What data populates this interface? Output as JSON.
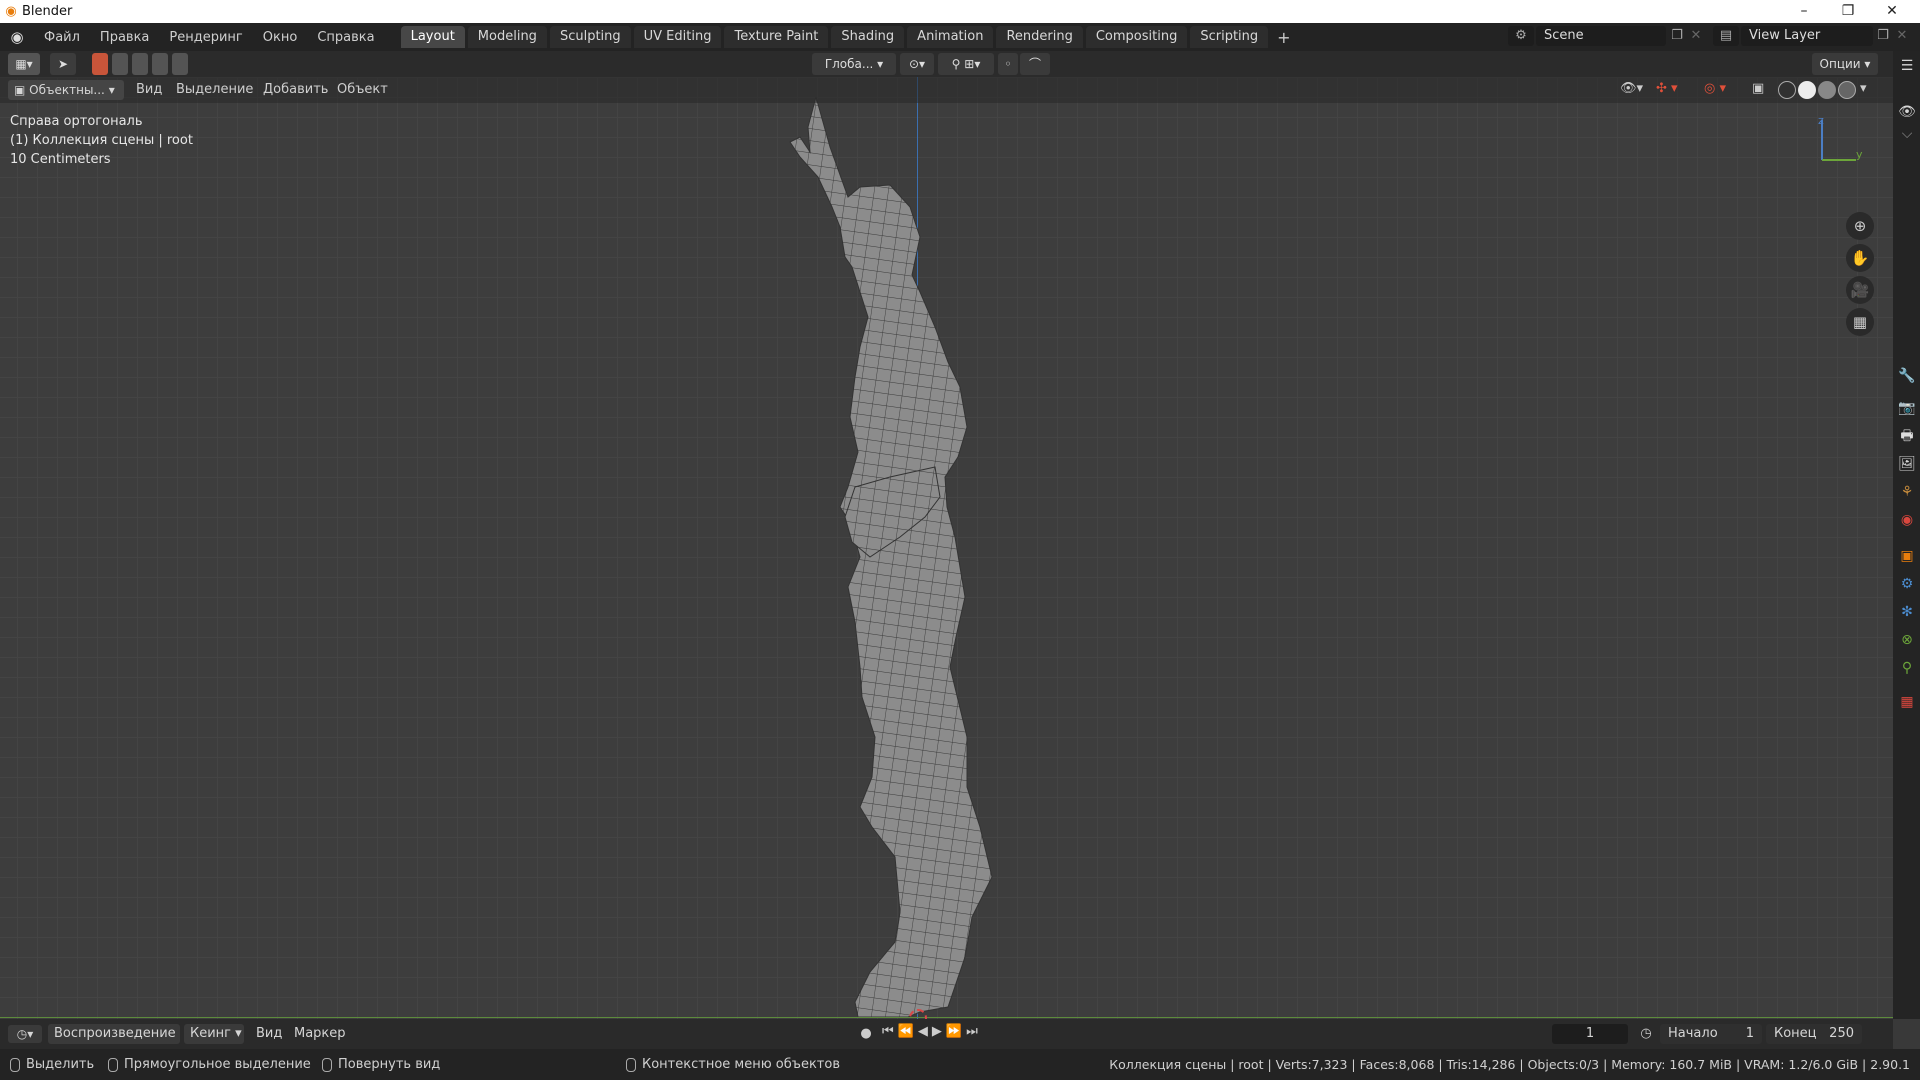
{
  "window": {
    "title": "Blender",
    "minimize": "–",
    "restore": "❐",
    "close": "✕"
  },
  "menu": [
    "Файл",
    "Правка",
    "Рендеринг",
    "Окно",
    "Справка"
  ],
  "workspaces": [
    "Layout",
    "Modeling",
    "Sculpting",
    "UV Editing",
    "Texture Paint",
    "Shading",
    "Animation",
    "Rendering",
    "Compositing",
    "Scripting"
  ],
  "active_workspace": "Layout",
  "add_workspace": "+",
  "scene": "Scene",
  "view_layer": "View Layer",
  "header": {
    "transform_orientation": "Глоба...",
    "options": "Опции"
  },
  "viewport_header": {
    "mode": "Объектны...",
    "items": [
      "Вид",
      "Выделение",
      "Добавить",
      "Объект"
    ]
  },
  "overlay": {
    "view": "Справа ортогональ",
    "collection": "(1) Коллекция сцены | root",
    "scale": "10 Centimeters"
  },
  "gizmo": {
    "z": "z",
    "y": "y"
  },
  "timeline": {
    "playback": "Воспроизведение",
    "keying": "Кеинг",
    "view": "Вид",
    "marker": "Маркер",
    "current_frame": "1",
    "start_label": "Начало",
    "start": "1",
    "end_label": "Конец",
    "end": "250"
  },
  "status": {
    "select": "Выделить",
    "box_select": "Прямоугольное выделение",
    "rotate": "Повернуть вид",
    "context": "Контекстное меню объектов",
    "stats": "Коллекция сцены | root | Verts:7,323 | Faces:8,068 | Tris:14,286 | Objects:0/3 | Memory: 160.7 MiB | VRAM: 1.2/6.0 GiB | 2.90.1"
  },
  "colors": {
    "accent": "#e87d0d",
    "active_tab": "#474747",
    "x_axis": "#d9473e",
    "y_axis": "#6ca53a",
    "z_axis": "#4b7ec4"
  }
}
